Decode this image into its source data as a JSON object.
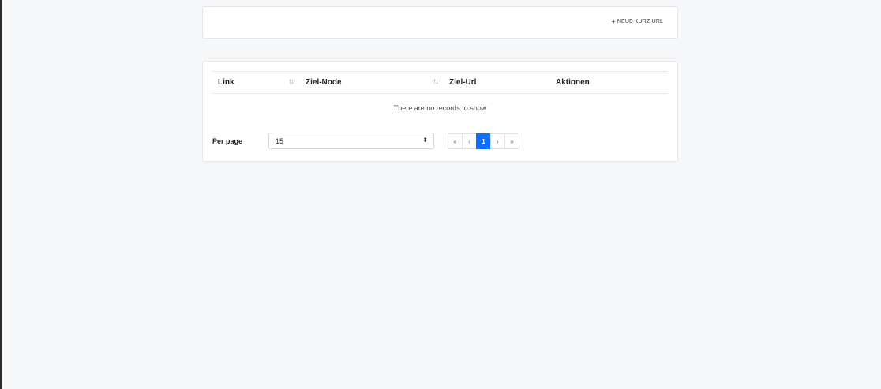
{
  "toolbar": {
    "new_button_icon": "plus-icon",
    "new_button_label": "NEUE KURZ-URL"
  },
  "table": {
    "columns": [
      {
        "label": "Link",
        "sortable": true
      },
      {
        "label": "Ziel-Node",
        "sortable": true
      },
      {
        "label": "Ziel-Url",
        "sortable": false
      },
      {
        "label": "Aktionen",
        "sortable": false
      }
    ],
    "sort_icon": "↑↓",
    "empty_message": "There are no records to show"
  },
  "pagination": {
    "per_page_label": "Per page",
    "per_page_value": "15",
    "first": "«",
    "prev": "‹",
    "current": "1",
    "next": "›",
    "last": "»"
  },
  "colors": {
    "accent": "#0d6efd",
    "background": "#f6f7f9"
  }
}
